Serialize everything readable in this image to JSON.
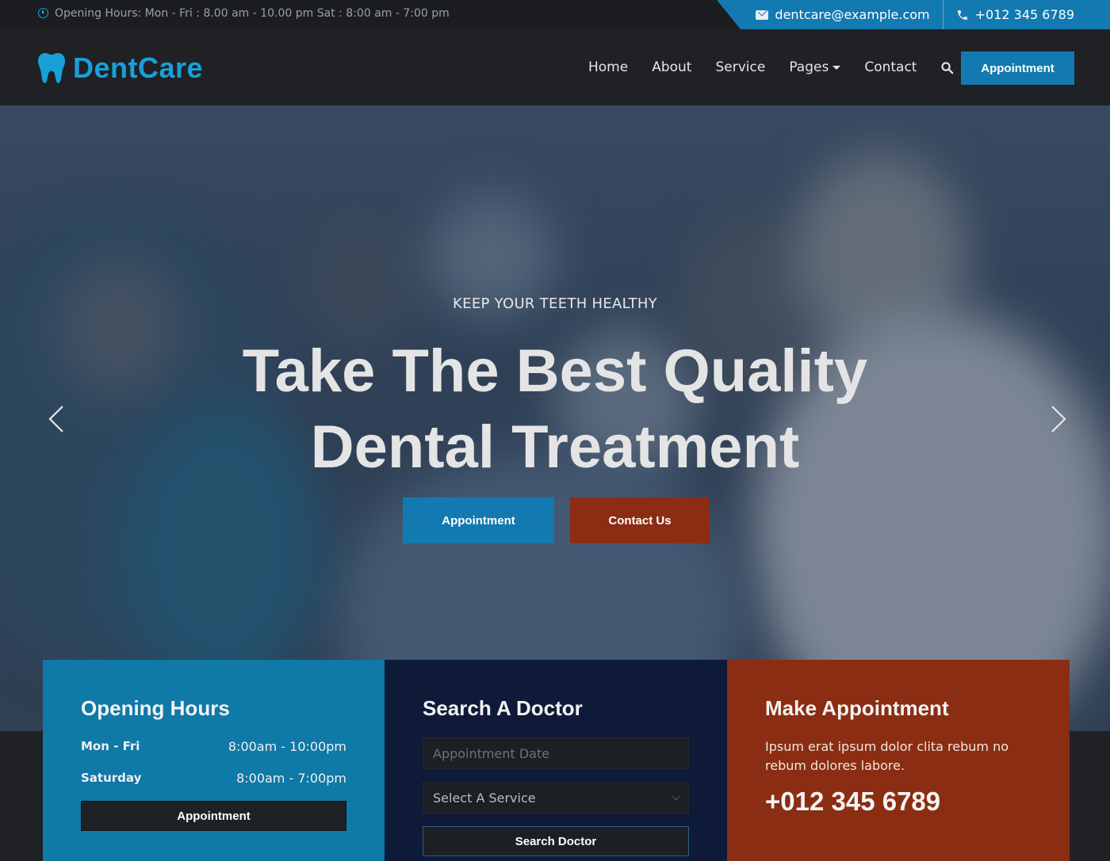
{
  "topbar": {
    "hours_text": "Opening Hours: Mon - Fri : 8.00 am - 10.00 pm Sat : 8:00 am - 7:00 pm",
    "email": "dentcare@example.com",
    "phone": "+012 345 6789",
    "icons": {
      "clock": "clock-icon",
      "email": "envelope-icon",
      "phone": "phone-icon"
    }
  },
  "navbar": {
    "brand": "DentCare",
    "links": [
      "Home",
      "About",
      "Service",
      "Pages",
      "Contact"
    ],
    "cta": "Appointment"
  },
  "hero": {
    "subtitle": "KEEP YOUR TEETH HEALTHY",
    "title_line1": "Take The Best Quality",
    "title_line2": "Dental Treatment",
    "btn_primary": "Appointment",
    "btn_secondary": "Contact Us"
  },
  "features": {
    "hours": {
      "title": "Opening Hours",
      "rows": [
        {
          "day": "Mon - Fri",
          "time": "8:00am - 10:00pm"
        },
        {
          "day": "Saturday",
          "time": "8:00am - 7:00pm"
        }
      ],
      "button": "Appointment"
    },
    "search": {
      "title": "Search A Doctor",
      "date_placeholder": "Appointment Date",
      "service_select": "Select A Service",
      "button": "Search Doctor"
    },
    "appointment": {
      "title": "Make Appointment",
      "text": "Ipsum erat ipsum dolor clita rebum no rebum dolores labore.",
      "phone": "+012 345 6789"
    }
  },
  "colors": {
    "primary": "#127ab0",
    "accent_red": "#8b2d12",
    "navy": "#0f1a38",
    "dark": "#1f2125"
  }
}
